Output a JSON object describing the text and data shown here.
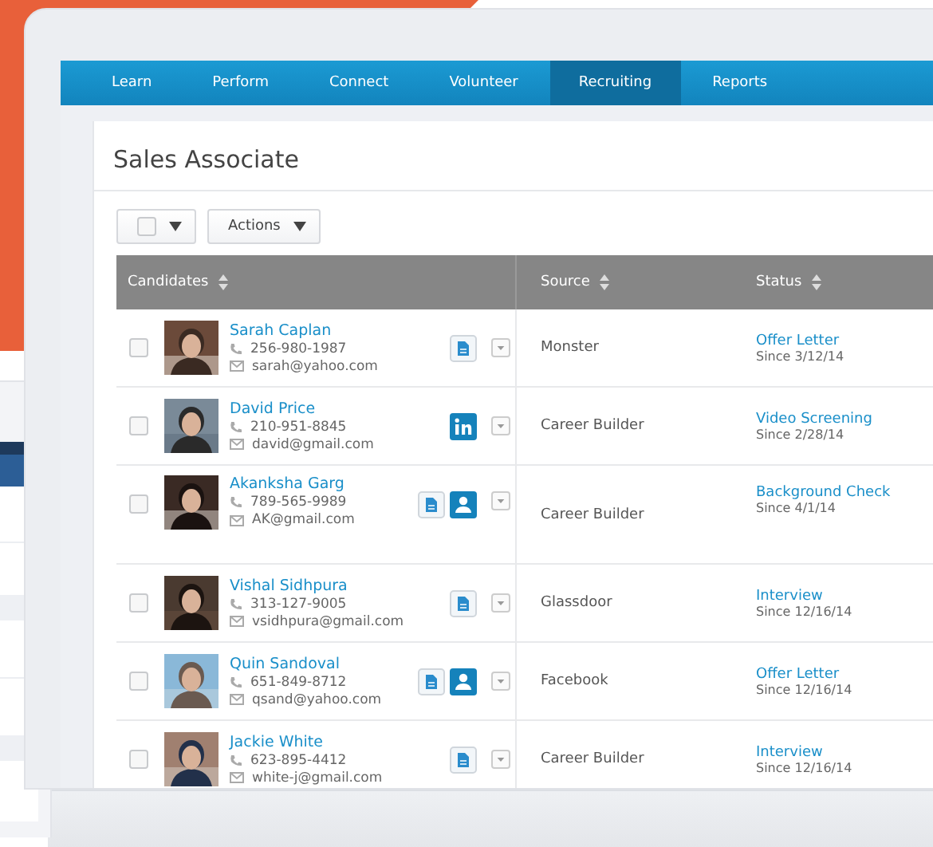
{
  "nav": {
    "tabs": [
      {
        "label": "Learn",
        "selected": false
      },
      {
        "label": "Perform",
        "selected": false
      },
      {
        "label": "Connect",
        "selected": false
      },
      {
        "label": "Volunteer",
        "selected": false
      },
      {
        "label": "Recruiting",
        "selected": true
      },
      {
        "label": "Reports",
        "selected": false
      }
    ]
  },
  "page": {
    "title": "Sales Associate"
  },
  "toolbar": {
    "select_all_checked": false,
    "actions_label": "Actions"
  },
  "table": {
    "columns": [
      "Candidates",
      "Source",
      "Status"
    ],
    "rows": [
      {
        "checked": false,
        "name": "Sarah Caplan",
        "phone": "256-980-1987",
        "email": "sarah@yahoo.com",
        "links": [
          {
            "kind": "resume"
          }
        ],
        "source": "Monster",
        "status": "Offer Letter",
        "since": "Since 3/12/14",
        "tall": false
      },
      {
        "checked": false,
        "name": "David Price",
        "phone": "210-951-8845",
        "email": "david@gmail.com",
        "links": [
          {
            "kind": "linkedin"
          }
        ],
        "source": "Career Builder",
        "status": "Video Screening",
        "since": "Since 2/28/14",
        "tall": false
      },
      {
        "checked": false,
        "name": "Akanksha Garg",
        "phone": "789-565-9989",
        "email": "AK@gmail.com",
        "links": [
          {
            "kind": "resume"
          },
          {
            "kind": "profile"
          }
        ],
        "source": "Career Builder",
        "status": "Background Check",
        "since": "Since 4/1/14",
        "tall": true
      },
      {
        "checked": false,
        "name": "Vishal Sidhpura",
        "phone": "313-127-9005",
        "email": "vsidhpura@gmail.com",
        "links": [
          {
            "kind": "resume"
          }
        ],
        "source": "Glassdoor",
        "status": "Interview",
        "since": "Since 12/16/14",
        "tall": false
      },
      {
        "checked": false,
        "name": "Quin Sandoval",
        "phone": "651-849-8712",
        "email": "qsand@yahoo.com",
        "links": [
          {
            "kind": "resume"
          },
          {
            "kind": "profile"
          }
        ],
        "source": "Facebook",
        "status": "Offer Letter",
        "since": "Since 12/16/14",
        "tall": false
      },
      {
        "checked": false,
        "name": "Jackie White",
        "phone": "623-895-4412",
        "email": "white-j@gmail.com",
        "links": [
          {
            "kind": "resume"
          }
        ],
        "source": "Career Builder",
        "status": "Interview",
        "since": "Since 12/16/14",
        "tall": false
      }
    ]
  }
}
